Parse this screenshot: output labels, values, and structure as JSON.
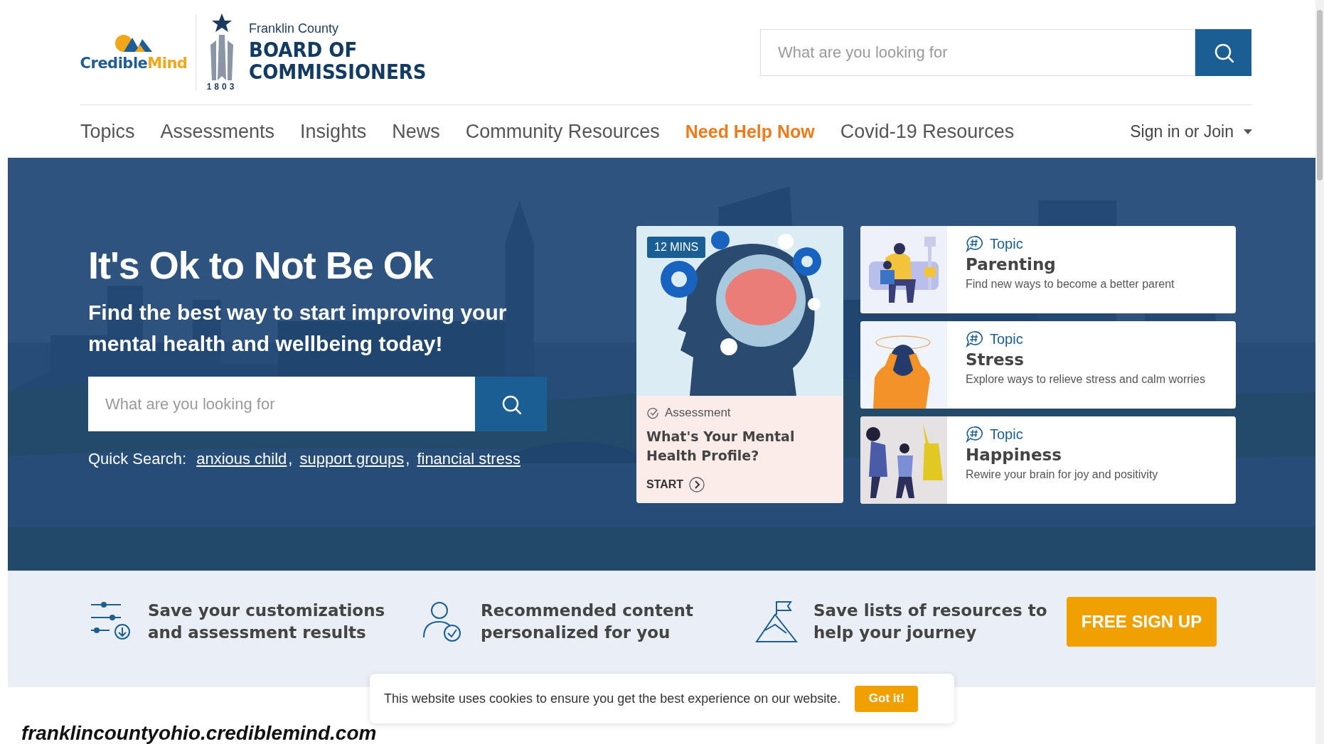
{
  "header": {
    "logo": {
      "brand_primary": "Credible",
      "brand_secondary": "Mind"
    },
    "partner_logo": {
      "county": "Franklin County",
      "title_line1": "BOARD OF",
      "title_line2": "COMMISSIONERS",
      "year": "1803"
    },
    "search": {
      "placeholder": "What are you looking for"
    }
  },
  "nav": {
    "items": [
      {
        "label": "Topics",
        "highlighted": false
      },
      {
        "label": "Assessments",
        "highlighted": false
      },
      {
        "label": "Insights",
        "highlighted": false
      },
      {
        "label": "News",
        "highlighted": false
      },
      {
        "label": "Community Resources",
        "highlighted": false
      },
      {
        "label": "Need Help Now",
        "highlighted": true
      },
      {
        "label": "Covid-19 Resources",
        "highlighted": false
      }
    ],
    "account": "Sign in or Join"
  },
  "hero": {
    "title": "It's Ok to Not Be Ok",
    "subtitle": "Find the best way to start improving your mental health and wellbeing today!",
    "search": {
      "placeholder": "What are you looking for"
    },
    "quick_search": {
      "label": "Quick Search:",
      "separator": ",",
      "links": [
        "anxious child",
        "support groups",
        "financial stress"
      ]
    },
    "assessment": {
      "badge": "12 MINS",
      "kind_label": "Assessment",
      "title": "What's Your Mental Health Profile?",
      "action": "START"
    },
    "topics": [
      {
        "kind_label": "Topic",
        "title": "Parenting",
        "description": "Find new ways to become a better parent"
      },
      {
        "kind_label": "Topic",
        "title": "Stress",
        "description": "Explore ways to relieve stress and calm worries"
      },
      {
        "kind_label": "Topic",
        "title": "Happiness",
        "description": "Rewire your brain for joy and positivity"
      }
    ]
  },
  "benefits": [
    {
      "text": "Save your customizations\nand assessment results"
    },
    {
      "text": "Recommended content\npersonalized for you"
    },
    {
      "text": "Save lists of resources to\nhelp your journey"
    }
  ],
  "signup_button": "FREE SIGN UP",
  "cookie": {
    "message": "This website uses cookies to ensure you get the best experience on our website.",
    "button": "Got it!"
  },
  "footer_url": "franklincountyohio.crediblemind.com"
}
